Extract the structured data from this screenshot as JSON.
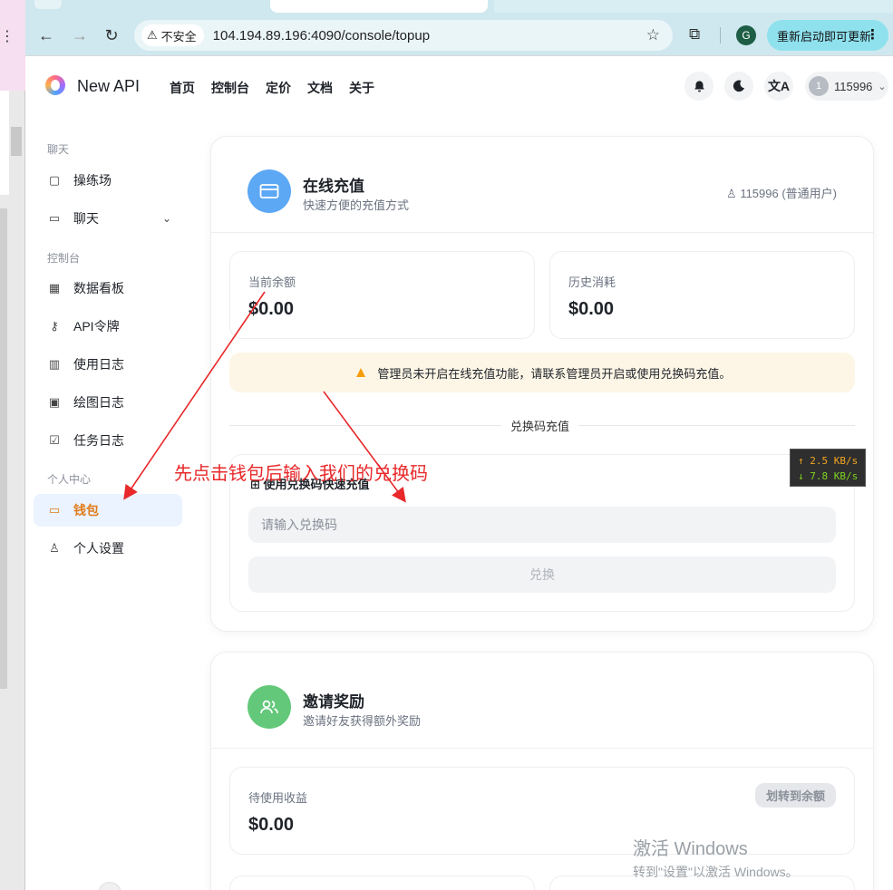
{
  "browser": {
    "security_label": "不安全",
    "url": "104.194.89.196:4090/console/topup",
    "profile_initial": "G",
    "update_label": "重新启动即可更新"
  },
  "app": {
    "brand": "New API",
    "nav": [
      "首页",
      "控制台",
      "定价",
      "文档",
      "关于"
    ],
    "user": {
      "avatar_initial": "1",
      "name": "115996"
    }
  },
  "sidebar": {
    "section_chat": "聊天",
    "item_playground": "操练场",
    "item_chat": "聊天",
    "section_console": "控制台",
    "item_dashboard": "数据看板",
    "item_api_token": "API令牌",
    "item_usage_log": "使用日志",
    "item_drawing_log": "绘图日志",
    "item_task_log": "任务日志",
    "section_personal": "个人中心",
    "item_wallet": "钱包",
    "item_settings": "个人设置"
  },
  "topup": {
    "title": "在线充值",
    "subtitle": "快速方便的充值方式",
    "user_label": "115996 (普通用户)",
    "balance_label": "当前余额",
    "balance_value": "$0.00",
    "history_label": "历史消耗",
    "history_value": "$0.00",
    "notice": "管理员未开启在线充值功能，请联系管理员开启或使用兑换码充值。",
    "divider_label": "兑换码充值",
    "redeem_title": "使用兑换码快速充值",
    "redeem_placeholder": "请输入兑换码",
    "redeem_button": "兑换"
  },
  "invite": {
    "title": "邀请奖励",
    "subtitle": "邀请好友获得额外奖励",
    "pending_label": "待使用收益",
    "pending_value": "$0.00",
    "transfer_button": "划转到余额"
  },
  "overlay": {
    "annotation": "先点击钱包后输入我们的兑换码",
    "speed_up": "↑ 2.5 KB/s",
    "speed_down": "↓ 7.8 KB/s",
    "watermark_title": "激活 Windows",
    "watermark_sub": "转到\"设置\"以激活 Windows。"
  }
}
